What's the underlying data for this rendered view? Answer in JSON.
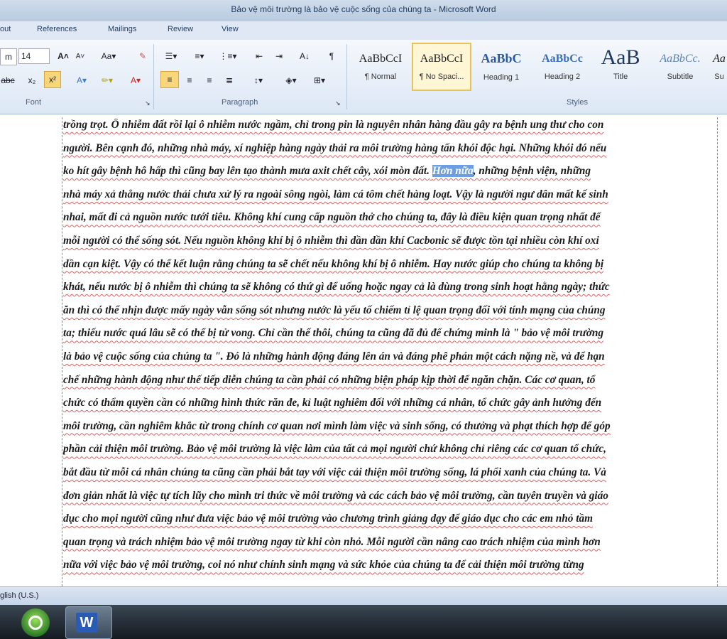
{
  "window": {
    "title": "Bảo vệ môi trường là bảo vệ cuộc sống của chúng ta - Microsoft Word"
  },
  "tabs": [
    {
      "label": "out"
    },
    {
      "label": "References"
    },
    {
      "label": "Mailings"
    },
    {
      "label": "Review"
    },
    {
      "label": "View"
    }
  ],
  "font": {
    "size": "14",
    "group_label": "Font"
  },
  "paragraph": {
    "group_label": "Paragraph"
  },
  "styles": {
    "group_label": "Styles",
    "items": [
      {
        "sample": "AaBbCcI",
        "name": "¶ Normal"
      },
      {
        "sample": "AaBbCcI",
        "name": "¶ No Spaci..."
      },
      {
        "sample": "AaBbC",
        "name": "Heading 1"
      },
      {
        "sample": "AaBbCc",
        "name": "Heading 2"
      },
      {
        "sample": "AaB",
        "name": "Title"
      },
      {
        "sample": "AaBbCc.",
        "name": "Subtitle"
      },
      {
        "sample": "Aa",
        "name": "Su"
      }
    ]
  },
  "document": {
    "lines": [
      "trồng trọt. Ô nhiễm đất rồi lại ô nhiễm nước ngầm, chỉ trong pin là nguyên nhân hàng đầu gây ra bệnh ung thư cho con",
      "người. Bên cạnh đó, những nhà máy, xí nghiệp hàng ngày thải ra môi trường hàng tấn khói độc hại. Những khói đó nếu",
      "ko hít gây bệnh hô hấp thì cũng bay lên tạo thành mưa axit chết cây, xói mòn đất.",
      "nhà máy xả thẳng nước thải chưa xử lý ra ngoài sông ngòi, làm cá tôm chết hàng loạt. Vậy là người ngư dân mất kế sinh",
      "nhai, mất đi cả nguồn nước tưới tiêu. Không khí cung cấp nguồn thở cho chúng ta, đây là điều kiện quan trọng nhất để",
      "mỗi người có thể sống sót. Nếu nguồn không khí bị ô nhiễm thì dần dần khí Cacbonic sẽ được tồn tại nhiều còn khí oxi",
      "dần cạn kiệt. Vậy có thể kết luận rằng chúng ta sẽ chết nếu không khí bị ô nhiễm. Hay nước giúp cho chúng ta không bị",
      "khát, nếu nước bị ô nhiễm thì chúng ta sẽ không có thứ gì để uống hoặc ngay cả là dùng trong sinh hoạt hằng ngày; thức",
      "ăn thì có thể nhịn được mấy ngày vẫn sống sót nhưng nước là yếu tố chiếm tỉ lệ quan trọng đối với tính mạng của chúng",
      "ta; thiếu nước quá lâu sẽ có thể bị tử vong. Chỉ cần thế thôi, chúng ta cũng đã đủ để chứng minh là \" bảo vệ môi trường",
      "là bảo vệ cuộc sống của chúng ta \". Đó là những hành động đáng lên án và đáng phê phán một cách nặng nề, và để hạn",
      "chế những hành động như thế tiếp diễn chúng ta cần phải có những biện pháp kịp thời để ngăn chặn. Các cơ quan, tổ",
      "chức có thẩm quyền cần có những hình thức răn đe, kỉ luật nghiêm đối với những cá nhân, tổ chức gây ảnh hưởng đến",
      "môi trường, cần nghiêm khắc từ trong chính cơ quan nơi mình làm việc và sinh sống, có thưởng và phạt thích hợp để góp",
      "phần cải thiện môi trường. Bảo vệ môi trường là việc làm của tất cả mọi người chứ không chỉ riêng các cơ quan tổ chức,",
      "bắt đầu từ mỗi cá nhân chúng ta cũng cần phải bắt tay với việc cải thiện môi trường sống, lá phổi xanh của chúng ta. Và",
      "đơn giản nhất là việc tự tích lũy cho mình tri thức về môi trường và các cách bảo vệ môi trường, cần tuyên truyền và giáo",
      "dục cho mọi người cũng như đưa việc bảo vệ môi trường vào chương trình giảng dạy để giáo dục cho các em nhỏ tầm",
      "quan trọng và trách nhiệm bảo vệ môi trường ngay từ khi còn nhỏ. Mỗi người cần nâng cao trách nhiệm của mình hơn",
      "nữa với việc bảo vệ môi trường, coi nó như chính sinh mạng và sức khỏe của chúng ta để cải thiện môi trường từng"
    ],
    "highlight": "Hơn nữa",
    "line3_tail": ", những bệnh viện, những"
  },
  "status": {
    "language": "glish (U.S.)"
  },
  "taskbar": {
    "word_label": "W"
  }
}
